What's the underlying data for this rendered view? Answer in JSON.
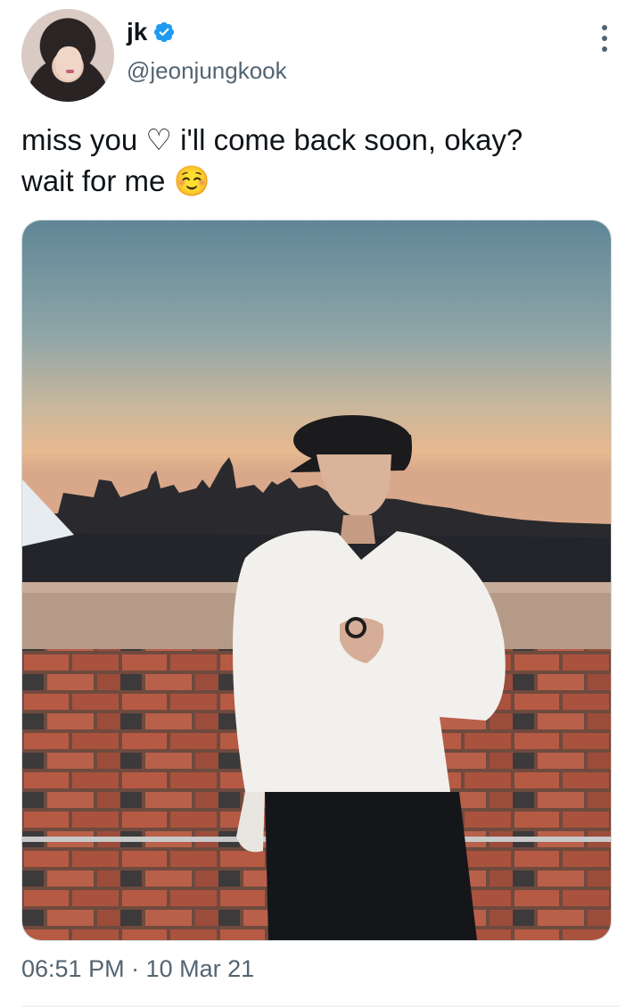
{
  "tweet": {
    "display_name": "jk",
    "handle": "@jeonjungkook",
    "text_line1": "miss you ♡ i'll come back soon, okay?",
    "text_line2": "wait for me ☺️",
    "timestamp": "06:51 PM · 10 Mar 21",
    "icons": {
      "verified": "verified-badge-icon",
      "more": "more-options-icon"
    },
    "colors": {
      "verified_blue": "#1d9bf0",
      "secondary_text": "#536471",
      "primary_text": "#0f1419"
    }
  }
}
